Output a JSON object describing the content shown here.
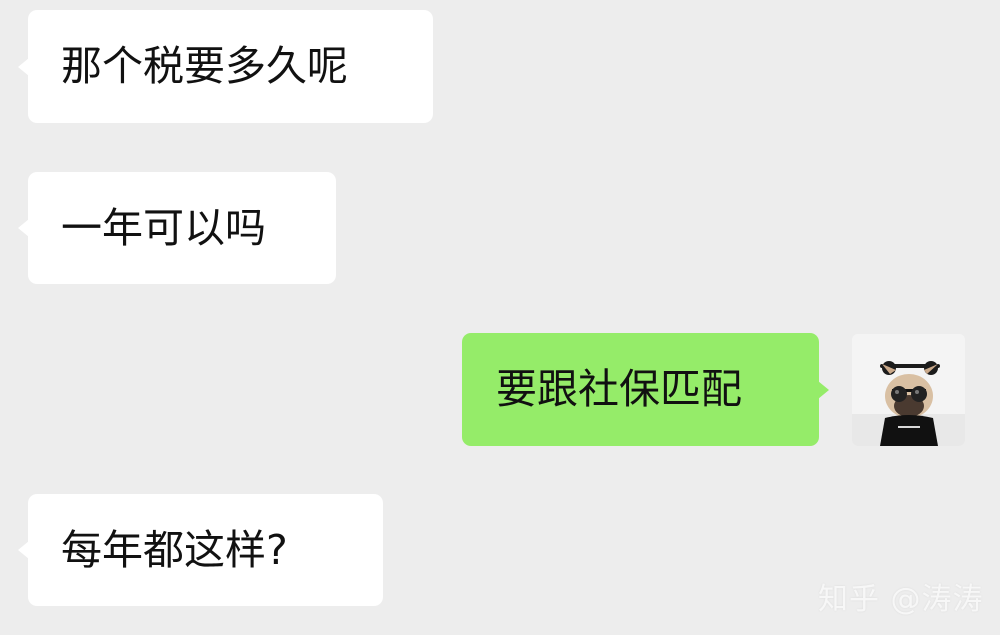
{
  "chat": {
    "messages": [
      {
        "direction": "incoming",
        "text": "那个税要多久呢"
      },
      {
        "direction": "incoming",
        "text": "一年可以吗"
      },
      {
        "direction": "outgoing",
        "text": "要跟社保匹配"
      },
      {
        "direction": "incoming",
        "text": "每年都这样?"
      }
    ],
    "avatar_icon": "dog-with-sunglasses-avatar"
  },
  "watermark": {
    "text": "知乎 @涛涛"
  },
  "colors": {
    "background": "#ededed",
    "incoming_bubble": "#ffffff",
    "outgoing_bubble": "#95ec69",
    "text": "#111111"
  }
}
